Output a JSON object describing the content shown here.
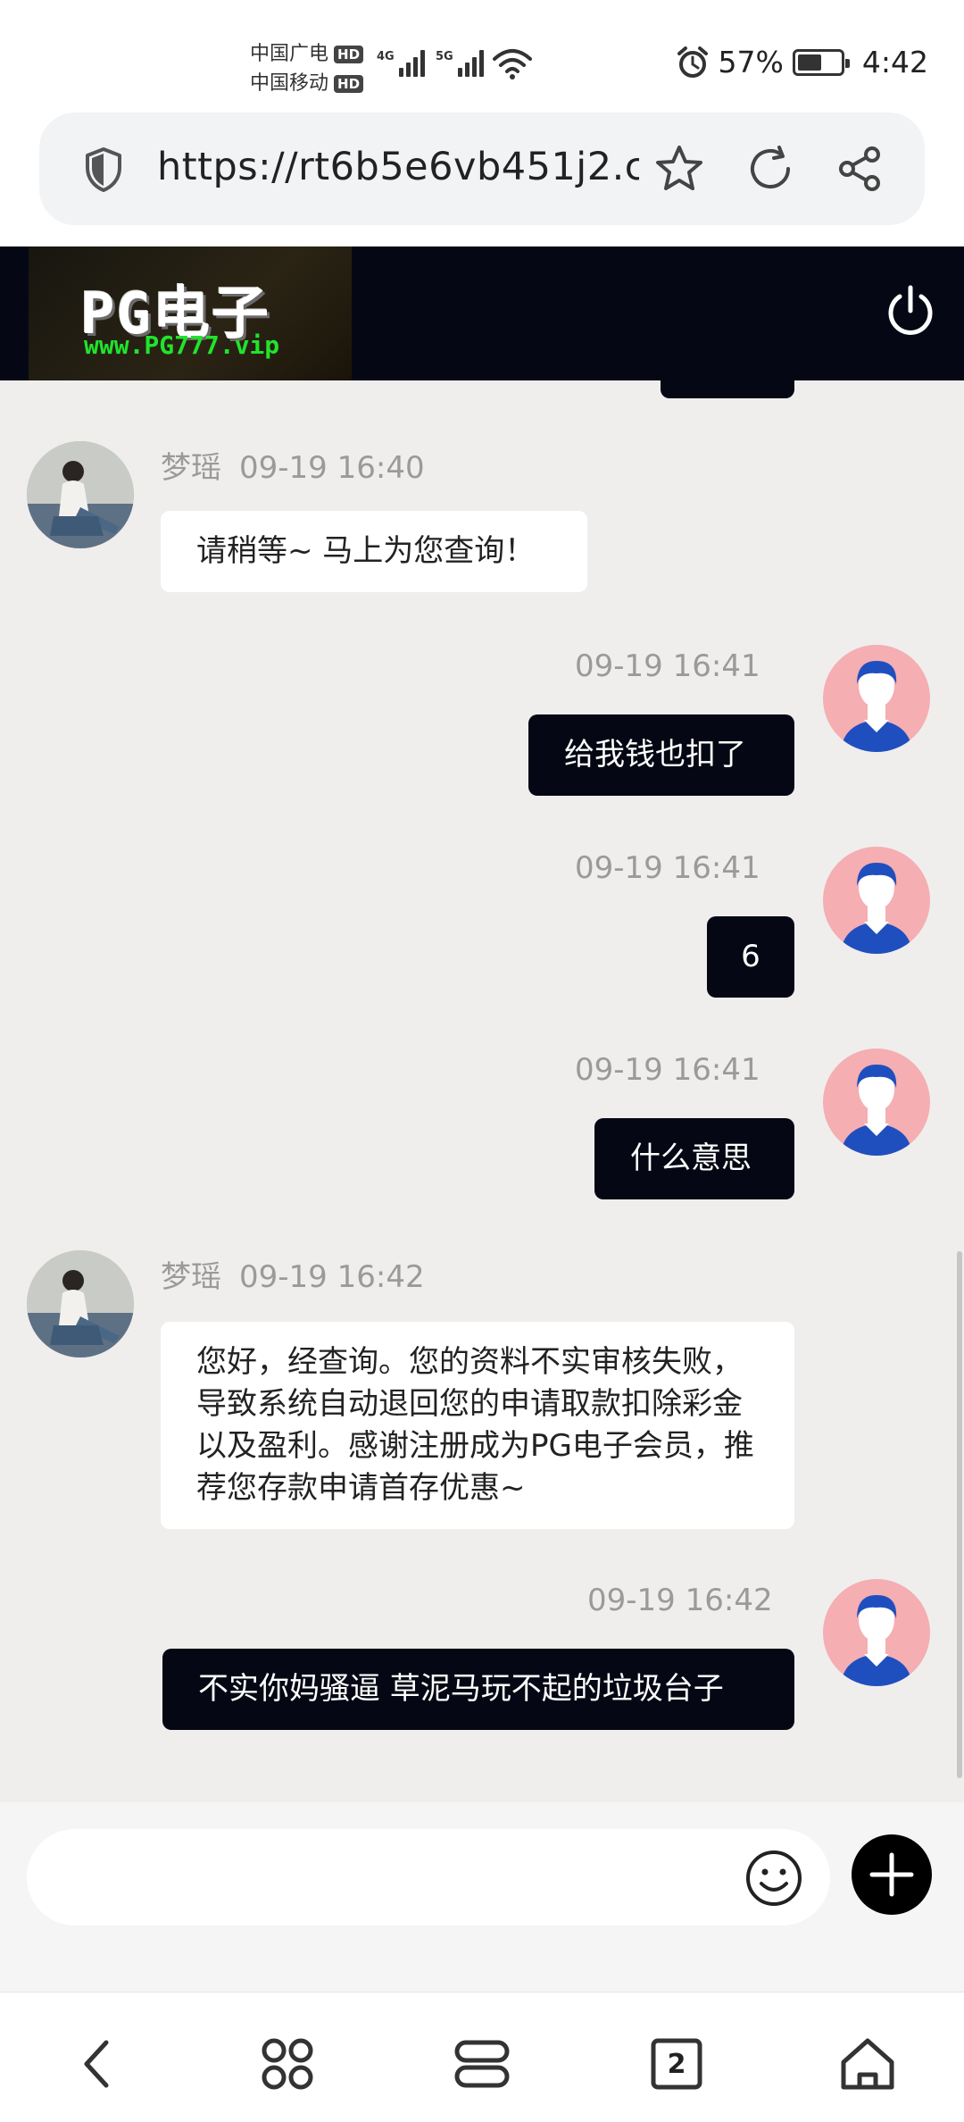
{
  "status_bar": {
    "carrier_1": "中国广电",
    "carrier_2": "中国移动",
    "hd_badge": "HD",
    "net_1": "4G",
    "net_2": "5G",
    "battery_percent": "57%",
    "battery_level": 0.57,
    "time": "4:42",
    "icons": [
      "signal-icon",
      "wifi-icon",
      "alarm-icon",
      "battery-icon"
    ]
  },
  "browser": {
    "url": "https://rt6b5e6vb451j2.c",
    "icons": [
      "shield-icon",
      "star-icon",
      "refresh-icon",
      "share-icon"
    ]
  },
  "site_header": {
    "logo_title": "PG电子",
    "logo_subtitle": "www.PG777.vip",
    "power_icon": "power-icon"
  },
  "messages": [
    {
      "side": "in",
      "name": "梦瑶",
      "time": "09-19 16:40",
      "text": "请稍等~ 马上为您查询！"
    },
    {
      "side": "out",
      "time": "09-19 16:41",
      "text": "给我钱也扣了"
    },
    {
      "side": "out",
      "time": "09-19 16:41",
      "text": "6"
    },
    {
      "side": "out",
      "time": "09-19 16:41",
      "text": "什么意思"
    },
    {
      "side": "in",
      "name": "梦瑶",
      "time": "09-19 16:42",
      "text": "您好，经查询。您的资料不实审核失败，导致系统自动退回您的申请取款扣除彩金以及盈利。感谢注册成为PG电子会员，推荐您存款申请首存优惠~"
    },
    {
      "side": "out",
      "time": "09-19 16:42",
      "text": "不实你妈骚逼 草泥马玩不起的垃圾台子"
    }
  ],
  "composer": {
    "placeholder": "",
    "icons": [
      "emoji-icon",
      "plus-icon"
    ]
  },
  "bottom_nav": {
    "tabs_count": "2",
    "icons": [
      "back-icon",
      "apps-icon",
      "menu-icon",
      "tabs-icon",
      "home-icon"
    ]
  },
  "colors": {
    "dark_bubble": "#050814",
    "chat_background": "#efeeed",
    "user_avatar_bg": "#f5aeb2",
    "user_avatar_figure": "#1f4fbf",
    "logo_green": "#21e32c"
  }
}
